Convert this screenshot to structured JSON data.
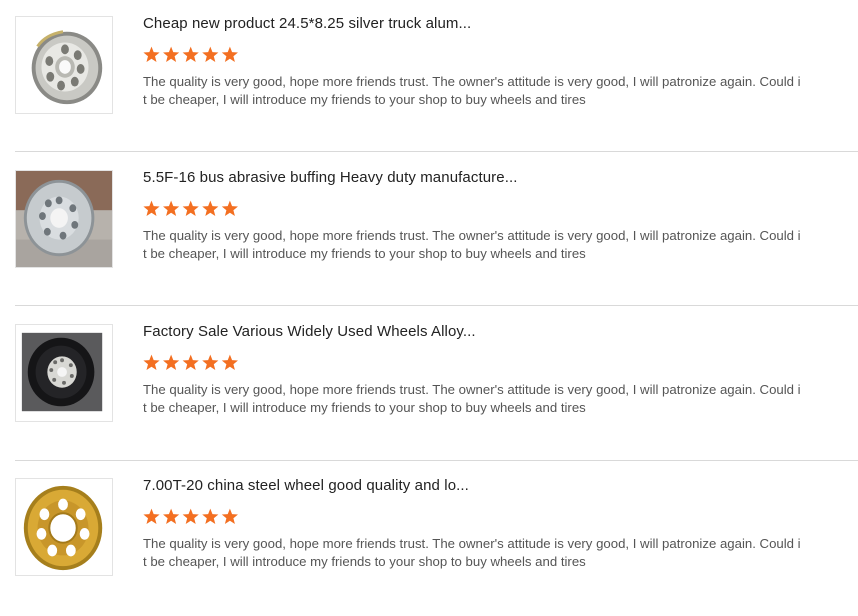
{
  "colors": {
    "star": "#f36f21",
    "divider": "#d9d9d9",
    "title": "#222222",
    "comment": "#555555"
  },
  "reviews": [
    {
      "title": "Cheap new product 24.5*8.25 silver truck alum...",
      "rating": 5,
      "comment": "The quality is very good, hope more friends trust. The owner's attitude is very good, I will patronize again. Could it be cheaper, I will introduce my friends to your shop to buy wheels and tires",
      "image_icon": "silver-aluminum-wheel-image"
    },
    {
      "title": "5.5F-16 bus abrasive buffing Heavy duty manufacture...",
      "rating": 5,
      "comment": "The quality is very good, hope more friends trust. The owner's attitude is very good, I will patronize again. Could it be cheaper, I will introduce my friends to your shop to buy wheels and tires",
      "image_icon": "grey-steel-wheel-image"
    },
    {
      "title": "Factory Sale Various Widely Used Wheels Alloy...",
      "rating": 5,
      "comment": "The quality is very good, hope more friends trust. The owner's attitude is very good, I will patronize again. Could it be cheaper, I will introduce my friends to your shop to buy wheels and tires",
      "image_icon": "black-wheel-image"
    },
    {
      "title": "7.00T-20 china steel wheel good quality and lo...",
      "rating": 5,
      "comment": "The quality is very good, hope more friends trust. The owner's attitude is very good, I will patronize again. Could it be cheaper, I will introduce my friends to your shop to buy wheels and tires",
      "image_icon": "yellow-steel-wheel-image"
    }
  ]
}
